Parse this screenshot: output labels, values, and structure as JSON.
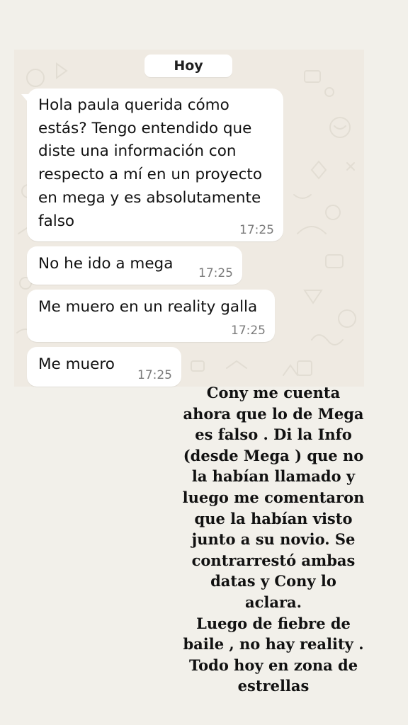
{
  "chat": {
    "date_chip": "Hoy",
    "messages": [
      {
        "lines": [
          "Hola paula querida cómo",
          "estás? Tengo entendido que",
          "diste una información con",
          "respecto a mí en un proyecto",
          "en mega y es absolutamente",
          "falso"
        ],
        "time": "17:25"
      },
      {
        "text": "No he ido a mega",
        "time": "17:25"
      },
      {
        "text": "Me muero en un reality galla",
        "time": "17:25"
      },
      {
        "text": "Me muero",
        "time": "17:25"
      }
    ]
  },
  "overlay": {
    "lines": [
      "Cony me cuenta",
      "ahora que lo de Mega",
      "es falso . Di la Info",
      "(desde Mega ) que no",
      "la habían llamado y",
      "luego me comentaron",
      "que la habían visto",
      "junto a su novio. Se",
      "contrarrestó ambas",
      "datas y Cony lo",
      "aclara.",
      "Luego de fiebre de",
      "baile , no hay reality .",
      "Todo hoy en zona de",
      "estrellas"
    ]
  },
  "colors": {
    "chat_background": "#efeae2",
    "page_background": "#f2f0ea",
    "bubble": "#ffffff",
    "timestamp": "#7b7b7b"
  }
}
